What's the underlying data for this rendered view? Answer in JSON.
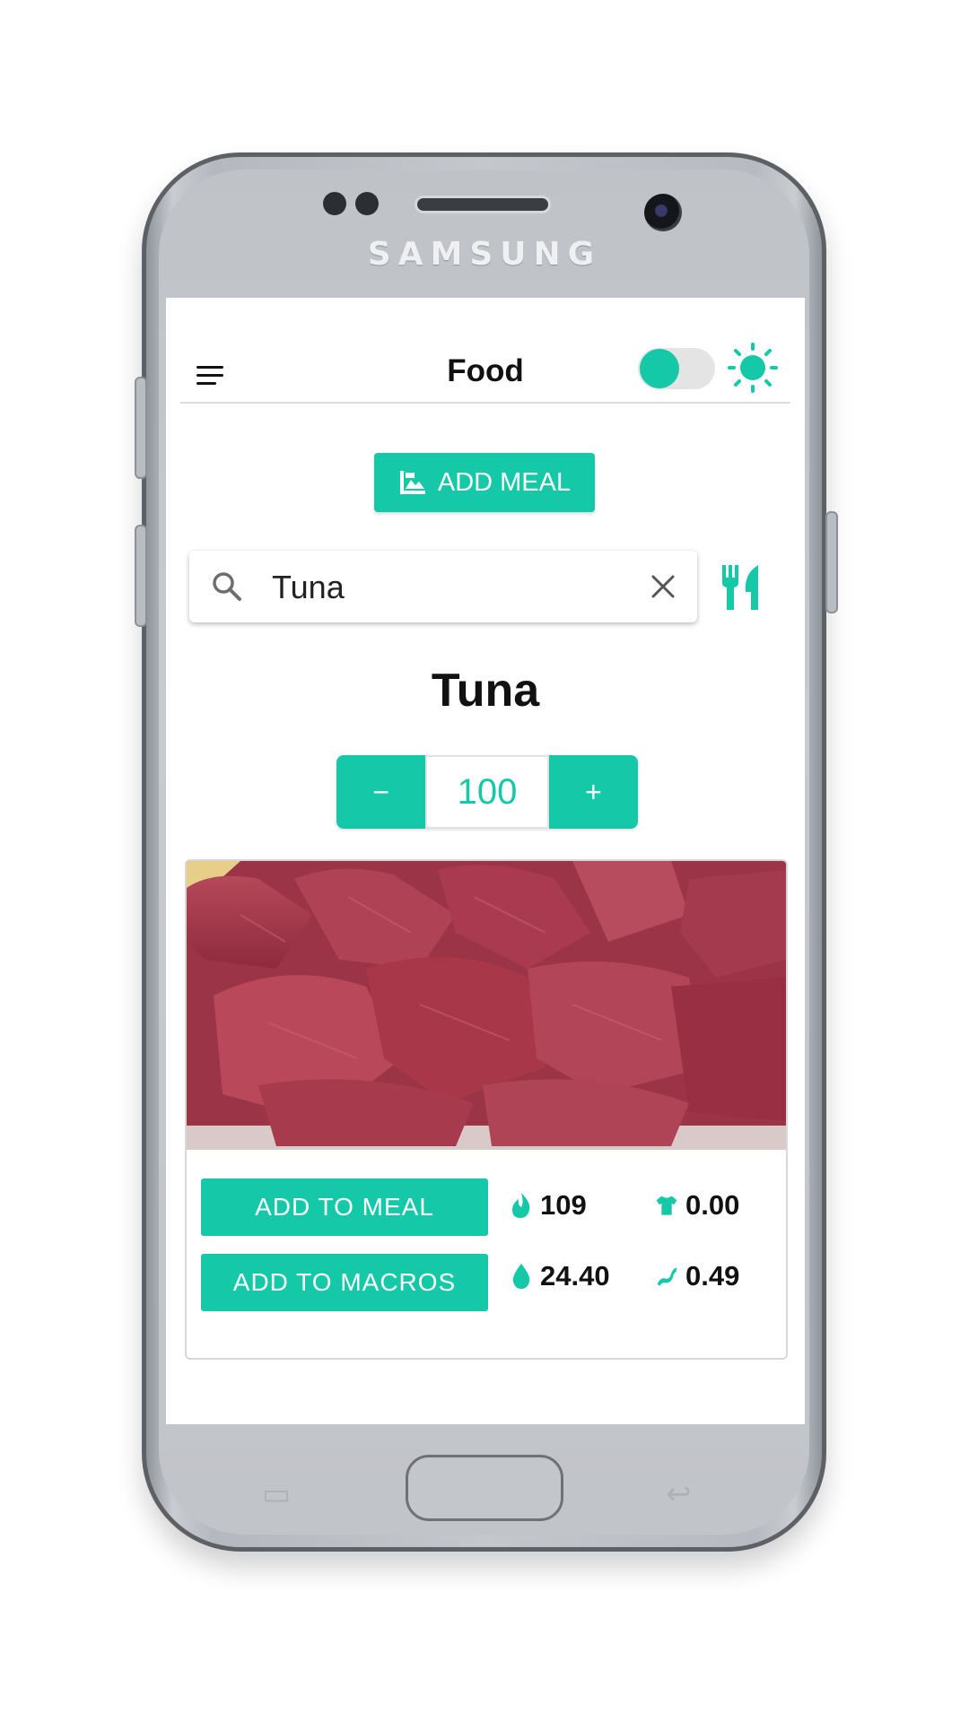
{
  "device": {
    "brand": "SAMSUNG"
  },
  "header": {
    "title": "Food",
    "theme_toggle_on": true
  },
  "actions": {
    "add_meal_label": "ADD MEAL"
  },
  "search": {
    "value": "Tuna",
    "placeholder": ""
  },
  "food": {
    "name": "Tuna",
    "quantity": "100",
    "decrement_label": "−",
    "increment_label": "+",
    "add_to_meal_label": "ADD TO MEAL",
    "add_to_macros_label": "ADD TO MACROS",
    "macros": {
      "calories": "109",
      "carbs": "0.00",
      "protein": "24.40",
      "fat": "0.49"
    }
  },
  "colors": {
    "accent": "#15c8a8"
  },
  "icons": [
    "menu-icon",
    "sun-icon",
    "image-icon",
    "search-icon",
    "close-icon",
    "cutlery-icon",
    "flame-icon",
    "shirt-icon",
    "drop-icon",
    "fat-strip-icon"
  ]
}
